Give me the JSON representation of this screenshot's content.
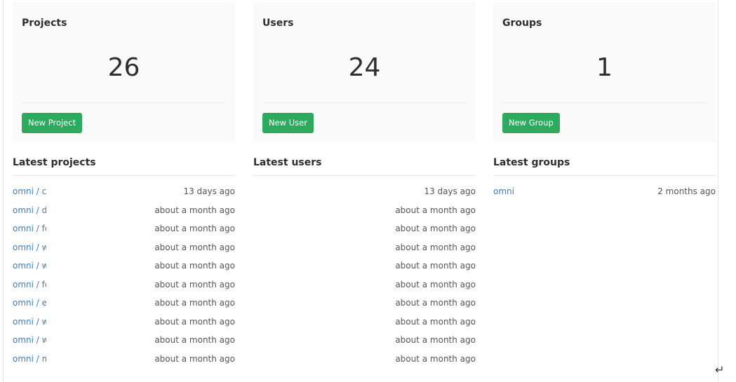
{
  "projects": {
    "title": "Projects",
    "count": "26",
    "button_label": "New Project",
    "latest_title": "Latest projects",
    "items": [
      {
        "name": "omni / ch",
        "time": "13 days ago"
      },
      {
        "name": "omni / da",
        "time": "about a month ago"
      },
      {
        "name": "omni / fo",
        "time": "about a month ago"
      },
      {
        "name": "omni / wo",
        "time": "about a month ago"
      },
      {
        "name": "omni / wo",
        "time": "about a month ago"
      },
      {
        "name": "omni / fo",
        "time": "about a month ago"
      },
      {
        "name": "omni / es",
        "time": "about a month ago"
      },
      {
        "name": "omni / wo",
        "time": "about a month ago"
      },
      {
        "name": "omni / wo",
        "time": "about a month ago"
      },
      {
        "name": "omni / m",
        "time": "about a month ago"
      }
    ]
  },
  "users": {
    "title": "Users",
    "count": "24",
    "button_label": "New User",
    "latest_title": "Latest users",
    "items": [
      {
        "time": "13 days ago"
      },
      {
        "time": "about a month ago"
      },
      {
        "time": "about a month ago"
      },
      {
        "time": "about a month ago"
      },
      {
        "time": "about a month ago"
      },
      {
        "time": "about a month ago"
      },
      {
        "time": "about a month ago"
      },
      {
        "time": "about a month ago"
      },
      {
        "time": "about a month ago"
      },
      {
        "time": "about a month ago"
      }
    ]
  },
  "groups": {
    "title": "Groups",
    "count": "1",
    "button_label": "New Group",
    "latest_title": "Latest groups",
    "items": [
      {
        "name": "omni",
        "time": "2 months ago"
      }
    ]
  },
  "colors": {
    "button_green": "#2eaa5f",
    "link_blue": "#3f7cb8",
    "card_bg": "#fafafa"
  },
  "icons": {
    "cursor": "return-arrow-icon"
  }
}
